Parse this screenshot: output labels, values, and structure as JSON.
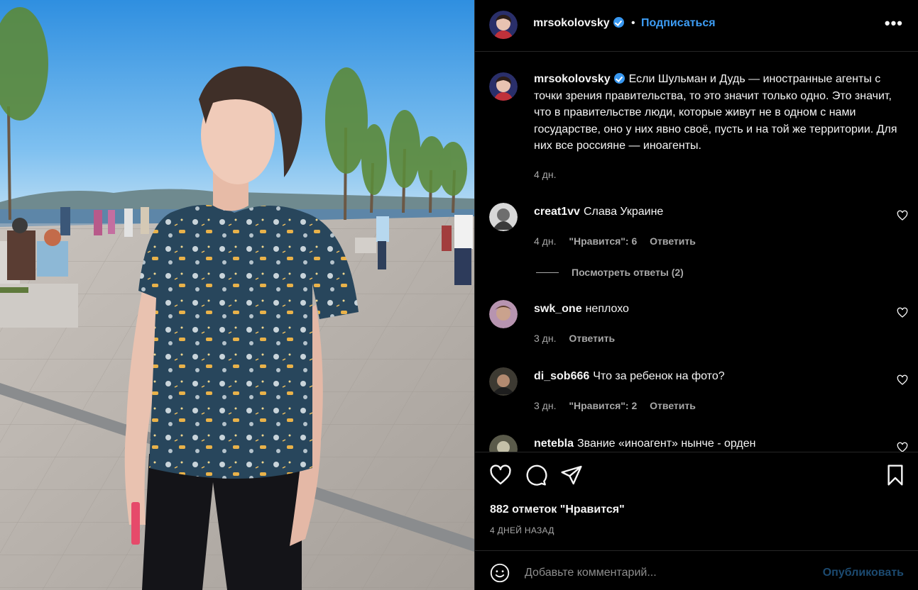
{
  "post": {
    "author": "mrsokolovsky",
    "follow_label": "Подписаться",
    "dot": "•",
    "more_label": "•••"
  },
  "caption": {
    "username": "mrsokolovsky",
    "text": "Если Шульман и Дудь — иностранные агенты с точки зрения правительства, то это значит только одно. Это значит, что в правительстве люди, которые живут не в одном с нами государстве, оно у них явно своё, пусть и на той же территории. Для них все россияне — иноагенты.",
    "time": "4 дн."
  },
  "comments": [
    {
      "username": "creat1vv",
      "text": "Слава Украине",
      "time": "4 дн.",
      "likes": "\"Нравится\": 6",
      "reply": "Ответить"
    },
    {
      "username": "swk_one",
      "text": "неплохо",
      "time": "3 дн.",
      "likes": "",
      "reply": "Ответить"
    },
    {
      "username": "di_sob666",
      "text": "Что за ребенок на фото?",
      "time": "3 дн.",
      "likes": "\"Нравится\": 2",
      "reply": "Ответить"
    },
    {
      "username": "netebla",
      "text": "Звание «иноагент» нынче - орден"
    }
  ],
  "view_replies": "Посмотреть ответы (2)",
  "likes_summary": "882 отметок \"Нравится\"",
  "posted_ago": "4 ДНЕЙ НАЗАД",
  "add_comment": {
    "placeholder": "Добавьте комментарий...",
    "publish_label": "Опубликовать"
  },
  "icons": {
    "like": "heart-icon",
    "comment": "comment-bubble-icon",
    "share": "paper-plane-icon",
    "save": "bookmark-icon",
    "emoji": "emoji-icon",
    "verified": "verified-badge-icon",
    "more": "more-options-icon"
  },
  "colors": {
    "background": "#000000",
    "link_blue": "#3d9df5",
    "verified_blue": "#3897f0",
    "muted_text": "#a8a8a8",
    "publish_disabled": "#1c4a70"
  }
}
